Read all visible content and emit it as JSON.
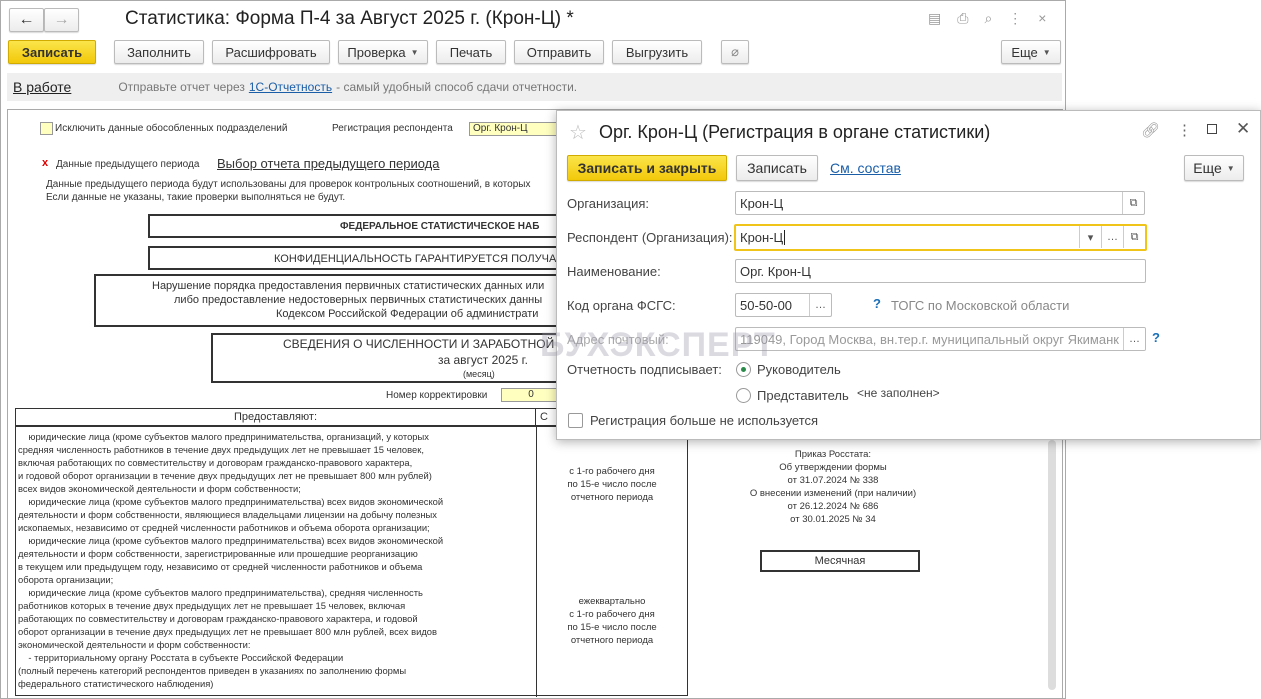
{
  "window": {
    "title": "Статистика: Форма П-4 за Август 2025 г. (Крон-Ц) *"
  },
  "toolbar": {
    "save": "Записать",
    "fill": "Заполнить",
    "decode": "Расшифровать",
    "check": "Проверка",
    "print": "Печать",
    "send": "Отправить",
    "export": "Выгрузить",
    "more": "Еще"
  },
  "infobar": {
    "status": "В работе",
    "text_before": "Отправьте отчет через",
    "link": "1С-Отчетность",
    "text_after": "- самый удобный способ сдачи отчетности."
  },
  "sheet": {
    "exclude_label": "Исключить данные обособленных подразделений",
    "reg_label": "Регистрация респондента",
    "reg_value": "Орг. Крон-Ц",
    "prev_mark": "x",
    "prev_label": "Данные предыдущего периода",
    "prev_link": "Выбор отчета предыдущего периода",
    "prev_note1": "Данные предыдущего периода будут использованы для проверок контрольных соотношений, в которых",
    "prev_note2": "Если данные не указаны, такие проверки выполняться не будут.",
    "fed": "ФЕДЕРАЛЬНОЕ СТАТИСТИЧЕСКОЕ НАБ",
    "conf": "КОНФИДЕНЦИАЛЬНОСТЬ  ГАРАНТИРУЕТСЯ  ПОЛУЧА",
    "viol1": "Нарушение порядка предоставления первичных статистических данных или",
    "viol2": "либо предоставление недостоверных первичных статистических данны",
    "viol3": "Кодексом Российской Федерации об администрати",
    "svod": "СВЕДЕНИЯ О ЧИСЛЕННОСТИ И ЗАРАБОТНОЙ",
    "period": "за август 2025 г.",
    "month": "(месяц)",
    "corr_label": "Номер корректировки",
    "corr_value": "0",
    "col1": "Предоставляют:",
    "col2": "С",
    "rows": [
      "    юридические лица (кроме субъектов малого предпринимательства, организаций, у которых",
      "средняя численность работников в течение двух предыдущих лет не превышает 15 человек,",
      "включая работающих по совместительству и договорам гражданско-правового характера,",
      "и годовой оборот организации в течение двух предыдущих лет не превышает 800 млн рублей)",
      "всех видов экономической деятельности и форм собственности;",
      "    юридические лица (кроме субъектов малого предпринимательства) всех видов экономической",
      "деятельности и форм собственности, являющиеся владельцами лицензии на добычу полезных",
      "ископаемых, независимо от средней численности работников и объема оборота организации;",
      "    юридические лица (кроме субъектов малого предпринимательства) всех видов экономической",
      "деятельности и форм собственности, зарегистрированные или прошедшие реорганизацию",
      "в текущем или предыдущем году, независимо от средней численности работников и объема",
      "оборота организации;",
      "    юридические лица (кроме субъектов малого предпринимательства), средняя численность",
      "работников которых в течение двух предыдущих лет не превышает 15 человек, включая",
      "работающих по совместительству и договорам гражданско-правового характера, и годовой",
      "оборот организации в течение двух предыдущих лет не превышает 800 млн рублей, всех видов",
      "экономической деятельности и форм собственности:",
      "    - территориальному органу Росстата в субъекте Российской Федерации",
      "(полный перечень категорий респондентов приведен в указаниях по заполнению формы",
      "федерального статистического наблюдения)"
    ],
    "deadline1": [
      "с 1-го рабочего дня",
      "по 15-е число после",
      "отчетного периода"
    ],
    "deadline2": [
      "ежеквартально",
      "с 1-го рабочего дня",
      "по 15-е число после",
      "отчетного периода"
    ],
    "order": [
      "Приказ Росстата:",
      "Об утверждении формы",
      "от 31.07.2024 № 338",
      "О внесении изменений (при наличии)",
      "от 26.12.2024 № 686",
      "от 30.01.2025 № 34"
    ],
    "freq": "Месячная"
  },
  "dialog": {
    "title": "Орг. Крон-Ц (Регистрация в органе статистики)",
    "save_close": "Записать и закрыть",
    "save": "Записать",
    "composition": "См. состав",
    "more": "Еще",
    "org_label": "Организация:",
    "org_value": "Крон-Ц",
    "resp_label": "Респондент (Организация):",
    "resp_value": "Крон-Ц",
    "name_label": "Наименование:",
    "name_value": "Орг. Крон-Ц",
    "code_label": "Код органа ФСГС:",
    "code_value": "50-50-00",
    "code_desc": "ТОГС по Московской области",
    "addr_label": "Адрес почтовый:",
    "addr_value": "119049, Город Москва, вн.тер.г. муниципальный округ Якиманк",
    "signer_label": "Отчетность подписывает:",
    "signer_head": "Руководитель",
    "signer_rep": "Представитель",
    "rep_value": "<не заполнен>",
    "unused_label": "Регистрация больше не используется",
    "help": "?"
  },
  "watermark": "БУХЭКСПЕРТ",
  "colors": {
    "accent_yellow": "#f5d01e",
    "link": "#1a5ea8",
    "focus": "#f0c419"
  }
}
